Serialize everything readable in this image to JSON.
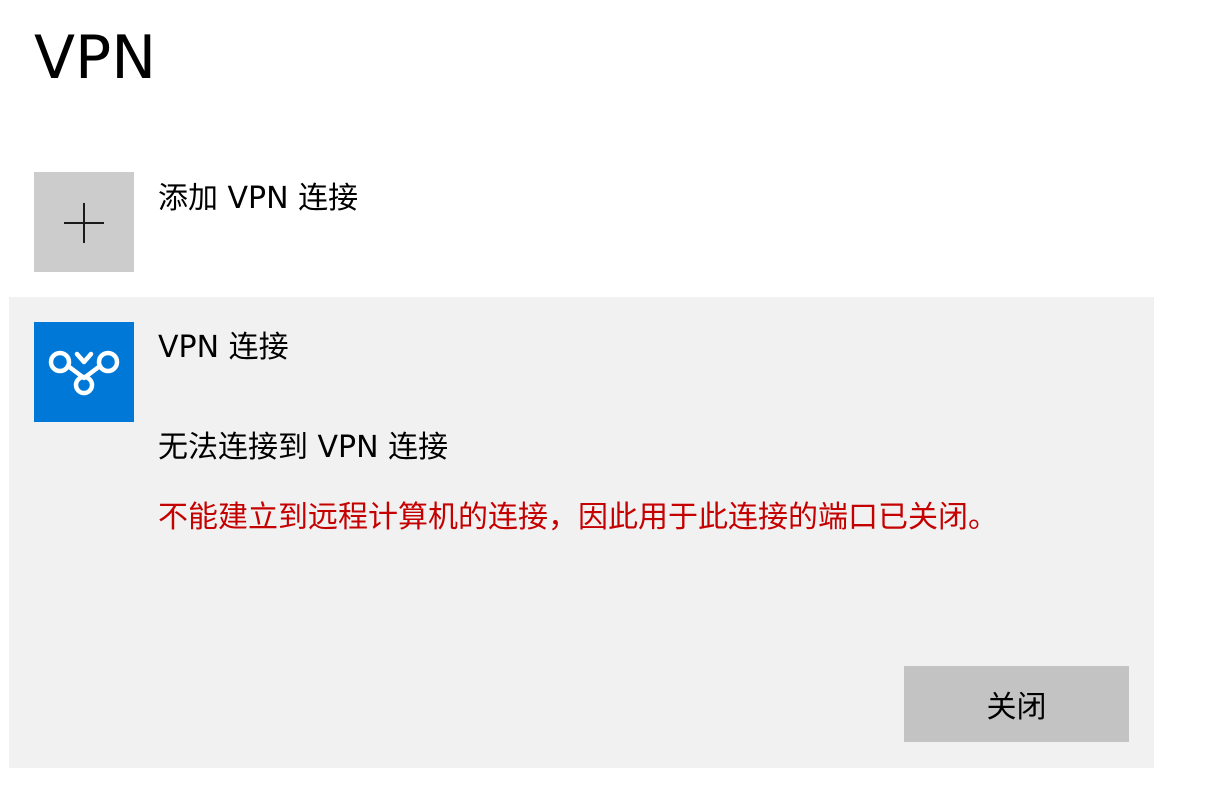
{
  "page": {
    "title": "VPN"
  },
  "add_connection": {
    "label": "添加 VPN 连接",
    "icon": "plus-icon"
  },
  "connection": {
    "name": "VPN 连接",
    "icon": "vpn-icon",
    "status": "无法连接到 VPN 连接",
    "error": "不能建立到远程计算机的连接，因此用于此连接的端口已关闭。",
    "close_label": "关闭"
  },
  "colors": {
    "accent": "#0078d7",
    "error": "#c50000",
    "card_background": "#f1f1f1",
    "add_tile_background": "#cccccc",
    "button_background": "#c3c3c3"
  }
}
